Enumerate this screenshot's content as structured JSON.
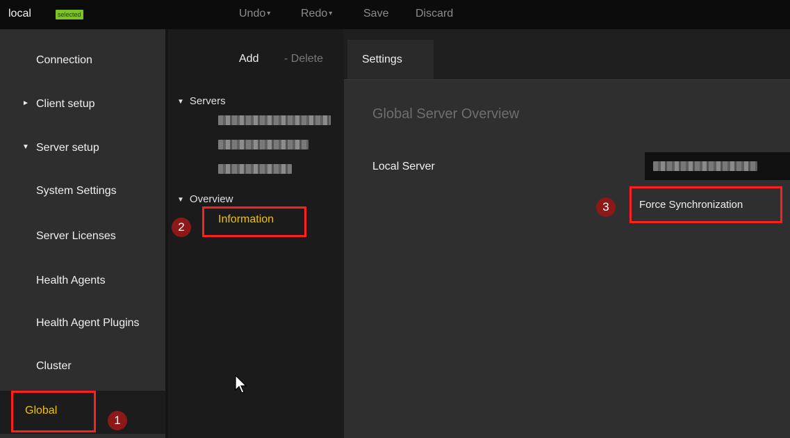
{
  "topbar": {
    "profile_name": "local",
    "profile_badge": "selected",
    "undo": "Undo",
    "redo": "Redo",
    "save": "Save",
    "discard": "Discard",
    "caret": "▾"
  },
  "sidebar": {
    "items": [
      {
        "label": "Connection"
      },
      {
        "label": "Client setup",
        "expander": "►"
      },
      {
        "label": "Server setup",
        "expander": "▼"
      },
      {
        "label": "System Settings"
      },
      {
        "label": "Server Licenses"
      },
      {
        "label": "Health Agents"
      },
      {
        "label": "Health Agent Plugins"
      },
      {
        "label": "Cluster"
      },
      {
        "label": "Global",
        "selected": true
      }
    ]
  },
  "middle": {
    "add": "Add",
    "delete": "- Delete",
    "tree": {
      "servers_label": "Servers",
      "overview_label": "Overview",
      "expander": "▼",
      "information_label": "Information"
    }
  },
  "right": {
    "tab_label": "Settings",
    "title": "Global Server Overview",
    "local_server_label": "Local Server",
    "force_sync_label": "Force Synchronization"
  },
  "annotations": {
    "badge_1": "1",
    "badge_2": "2",
    "badge_3": "3"
  },
  "colors": {
    "accent_yellow": "#f2c200",
    "highlight_red": "#ff1f1f",
    "badge_red": "#8c1818",
    "selected_green": "#7cc228"
  }
}
